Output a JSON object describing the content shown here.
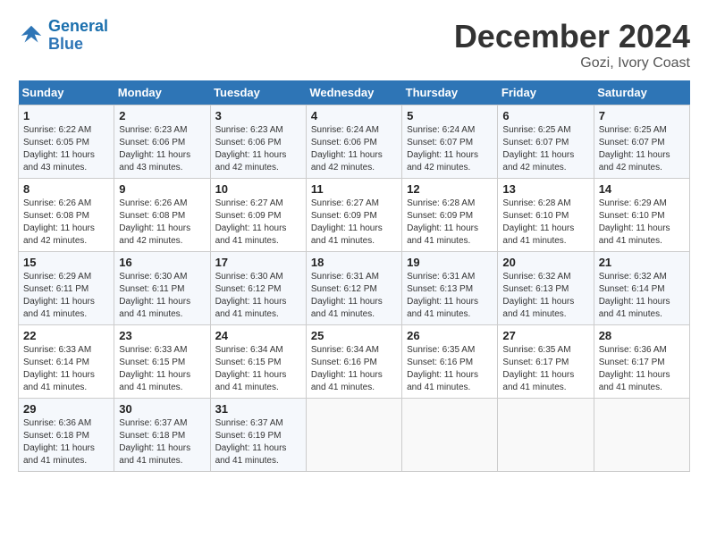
{
  "header": {
    "logo_line1": "General",
    "logo_line2": "Blue",
    "month_year": "December 2024",
    "location": "Gozi, Ivory Coast"
  },
  "days_of_week": [
    "Sunday",
    "Monday",
    "Tuesday",
    "Wednesday",
    "Thursday",
    "Friday",
    "Saturday"
  ],
  "weeks": [
    [
      {
        "day": "1",
        "info": "Sunrise: 6:22 AM\nSunset: 6:05 PM\nDaylight: 11 hours\nand 43 minutes."
      },
      {
        "day": "2",
        "info": "Sunrise: 6:23 AM\nSunset: 6:06 PM\nDaylight: 11 hours\nand 43 minutes."
      },
      {
        "day": "3",
        "info": "Sunrise: 6:23 AM\nSunset: 6:06 PM\nDaylight: 11 hours\nand 42 minutes."
      },
      {
        "day": "4",
        "info": "Sunrise: 6:24 AM\nSunset: 6:06 PM\nDaylight: 11 hours\nand 42 minutes."
      },
      {
        "day": "5",
        "info": "Sunrise: 6:24 AM\nSunset: 6:07 PM\nDaylight: 11 hours\nand 42 minutes."
      },
      {
        "day": "6",
        "info": "Sunrise: 6:25 AM\nSunset: 6:07 PM\nDaylight: 11 hours\nand 42 minutes."
      },
      {
        "day": "7",
        "info": "Sunrise: 6:25 AM\nSunset: 6:07 PM\nDaylight: 11 hours\nand 42 minutes."
      }
    ],
    [
      {
        "day": "8",
        "info": "Sunrise: 6:26 AM\nSunset: 6:08 PM\nDaylight: 11 hours\nand 42 minutes."
      },
      {
        "day": "9",
        "info": "Sunrise: 6:26 AM\nSunset: 6:08 PM\nDaylight: 11 hours\nand 42 minutes."
      },
      {
        "day": "10",
        "info": "Sunrise: 6:27 AM\nSunset: 6:09 PM\nDaylight: 11 hours\nand 41 minutes."
      },
      {
        "day": "11",
        "info": "Sunrise: 6:27 AM\nSunset: 6:09 PM\nDaylight: 11 hours\nand 41 minutes."
      },
      {
        "day": "12",
        "info": "Sunrise: 6:28 AM\nSunset: 6:09 PM\nDaylight: 11 hours\nand 41 minutes."
      },
      {
        "day": "13",
        "info": "Sunrise: 6:28 AM\nSunset: 6:10 PM\nDaylight: 11 hours\nand 41 minutes."
      },
      {
        "day": "14",
        "info": "Sunrise: 6:29 AM\nSunset: 6:10 PM\nDaylight: 11 hours\nand 41 minutes."
      }
    ],
    [
      {
        "day": "15",
        "info": "Sunrise: 6:29 AM\nSunset: 6:11 PM\nDaylight: 11 hours\nand 41 minutes."
      },
      {
        "day": "16",
        "info": "Sunrise: 6:30 AM\nSunset: 6:11 PM\nDaylight: 11 hours\nand 41 minutes."
      },
      {
        "day": "17",
        "info": "Sunrise: 6:30 AM\nSunset: 6:12 PM\nDaylight: 11 hours\nand 41 minutes."
      },
      {
        "day": "18",
        "info": "Sunrise: 6:31 AM\nSunset: 6:12 PM\nDaylight: 11 hours\nand 41 minutes."
      },
      {
        "day": "19",
        "info": "Sunrise: 6:31 AM\nSunset: 6:13 PM\nDaylight: 11 hours\nand 41 minutes."
      },
      {
        "day": "20",
        "info": "Sunrise: 6:32 AM\nSunset: 6:13 PM\nDaylight: 11 hours\nand 41 minutes."
      },
      {
        "day": "21",
        "info": "Sunrise: 6:32 AM\nSunset: 6:14 PM\nDaylight: 11 hours\nand 41 minutes."
      }
    ],
    [
      {
        "day": "22",
        "info": "Sunrise: 6:33 AM\nSunset: 6:14 PM\nDaylight: 11 hours\nand 41 minutes."
      },
      {
        "day": "23",
        "info": "Sunrise: 6:33 AM\nSunset: 6:15 PM\nDaylight: 11 hours\nand 41 minutes."
      },
      {
        "day": "24",
        "info": "Sunrise: 6:34 AM\nSunset: 6:15 PM\nDaylight: 11 hours\nand 41 minutes."
      },
      {
        "day": "25",
        "info": "Sunrise: 6:34 AM\nSunset: 6:16 PM\nDaylight: 11 hours\nand 41 minutes."
      },
      {
        "day": "26",
        "info": "Sunrise: 6:35 AM\nSunset: 6:16 PM\nDaylight: 11 hours\nand 41 minutes."
      },
      {
        "day": "27",
        "info": "Sunrise: 6:35 AM\nSunset: 6:17 PM\nDaylight: 11 hours\nand 41 minutes."
      },
      {
        "day": "28",
        "info": "Sunrise: 6:36 AM\nSunset: 6:17 PM\nDaylight: 11 hours\nand 41 minutes."
      }
    ],
    [
      {
        "day": "29",
        "info": "Sunrise: 6:36 AM\nSunset: 6:18 PM\nDaylight: 11 hours\nand 41 minutes."
      },
      {
        "day": "30",
        "info": "Sunrise: 6:37 AM\nSunset: 6:18 PM\nDaylight: 11 hours\nand 41 minutes."
      },
      {
        "day": "31",
        "info": "Sunrise: 6:37 AM\nSunset: 6:19 PM\nDaylight: 11 hours\nand 41 minutes."
      },
      {
        "day": "",
        "info": ""
      },
      {
        "day": "",
        "info": ""
      },
      {
        "day": "",
        "info": ""
      },
      {
        "day": "",
        "info": ""
      }
    ]
  ]
}
